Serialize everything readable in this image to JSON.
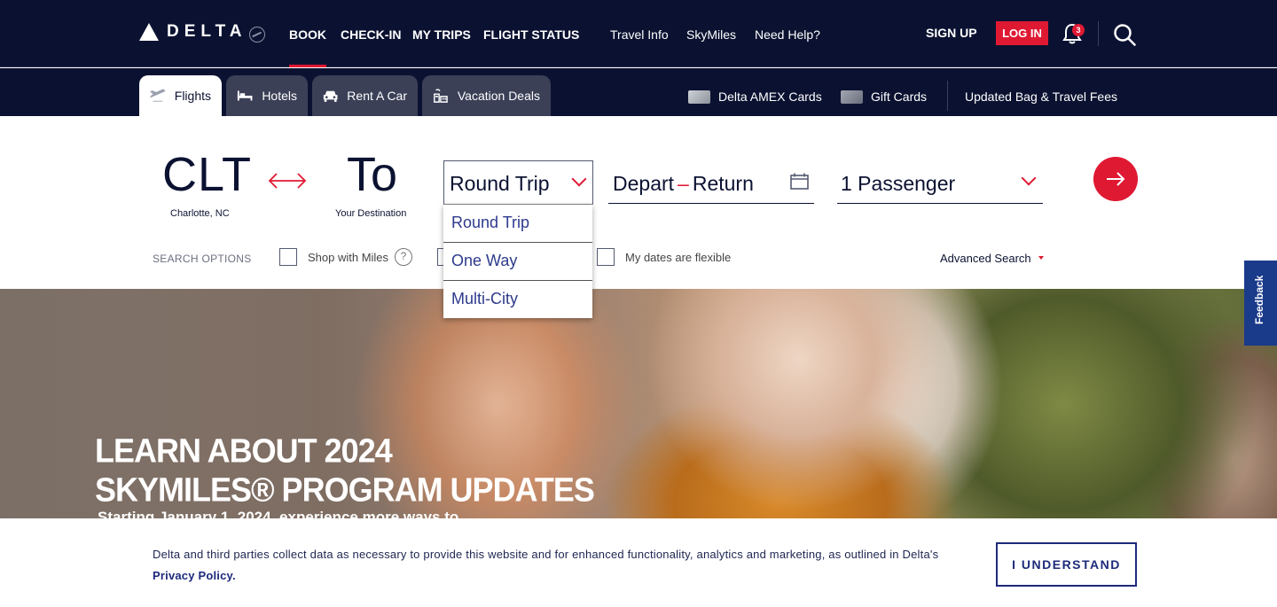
{
  "brand": {
    "name": "DELTA"
  },
  "topnav": {
    "main": [
      "BOOK",
      "CHECK-IN",
      "MY TRIPS",
      "FLIGHT STATUS"
    ],
    "secondary": [
      "Travel Info",
      "SkyMiles",
      "Need Help?"
    ],
    "signup": "SIGN UP",
    "login": "LOG IN",
    "notifications": "3"
  },
  "tabs": [
    "Flights",
    "Hotels",
    "Rent A Car",
    "Vacation Deals"
  ],
  "sublinks": {
    "amex": "Delta AMEX Cards",
    "gift": "Gift Cards",
    "fees": "Updated Bag & Travel Fees"
  },
  "booking": {
    "from_code": "CLT",
    "from_city": "Charlotte, NC",
    "to_code": "To",
    "to_city": "Your Destination",
    "trip_type": "Round Trip",
    "trip_options": [
      "Round Trip",
      "One Way",
      "Multi-City"
    ],
    "depart": "Depart",
    "return": "Return",
    "passengers": "1 Passenger"
  },
  "search_options": {
    "label": "SEARCH OPTIONS",
    "shop_miles": "Shop with Miles",
    "flexible": "My dates are flexible",
    "advanced": "Advanced Search"
  },
  "hero": {
    "line1": "LEARN ABOUT 2024",
    "line2": "SKYMILES® PROGRAM UPDATES",
    "sub": "Starting January 1, 2024, experience more ways to"
  },
  "feedback": "Feedback",
  "cookie": {
    "text": "Delta and third parties collect data as necessary to provide this website and for enhanced functionality, analytics and marketing, as outlined in Delta's",
    "link": "Privacy Policy.",
    "button": "I UNDERSTAND"
  },
  "colors": {
    "navy": "#0b1231",
    "red": "#e01933",
    "link_blue": "#1d2a7a"
  }
}
